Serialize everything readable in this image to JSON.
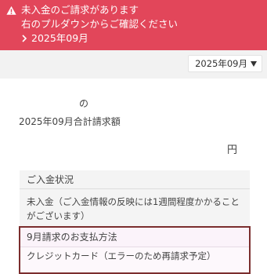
{
  "alert": {
    "title": "未入金のご請求があります",
    "subtitle": "右のプルダウンからご確認ください",
    "link": "2025年09月",
    "color": "#e2465a"
  },
  "month_select": {
    "value": "2025年09月"
  },
  "invoice": {
    "name_suffix": "の",
    "total_label": "2025年09月合計請求額",
    "currency": "円"
  },
  "payment_status": {
    "heading": "ご入金状況",
    "text": "未入金（ご入金情報の反映には1週間程度かかることがございます）"
  },
  "payment_method": {
    "heading": "9月請求のお支払方法",
    "text": "クレジットカード（エラーのため再請求予定）",
    "border_color": "#7b2e2e"
  }
}
